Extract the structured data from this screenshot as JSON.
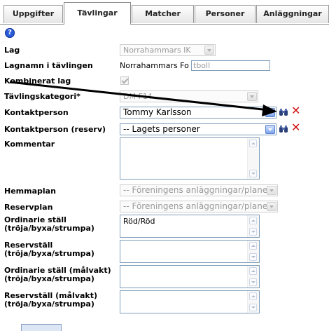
{
  "tabs": [
    "Uppgifter",
    "Tävlingar",
    "Matcher",
    "Personer",
    "Anläggningar"
  ],
  "active_tab": "Tävlingar",
  "help_icon": "?",
  "form": {
    "lag": {
      "label": "Lag",
      "value": "Norrahammars IK"
    },
    "lagnamn": {
      "label": "Lagnamn i tävlingen",
      "prefix": "Norrahammars Fo",
      "value": "tboll"
    },
    "kombinerat": {
      "label": "Kombinerat lag",
      "checked": true
    },
    "kategori": {
      "label": "Tävlingskategori*",
      "value": "DM F14"
    },
    "kontakt": {
      "label": "Kontaktperson",
      "value": "Tommy Karlsson"
    },
    "kontakt_reserv": {
      "label": "Kontaktperson (reserv)",
      "value": "-- Lagets personer"
    },
    "kommentar": {
      "label": "Kommentar",
      "value": ""
    },
    "hemmaplan": {
      "label": "Hemmaplan",
      "value": "-- Föreningens anläggningar/planer"
    },
    "reservplan": {
      "label": "Reservplan",
      "value": "-- Föreningens anläggningar/planer"
    },
    "ordinarie": {
      "label": "Ordinarie ställ (tröja/byxa/strumpa)",
      "value": "Röd/Röd"
    },
    "reservstall": {
      "label": "Reservställ (tröja/byxa/strumpa)",
      "value": ""
    },
    "ordinarie_malvakt": {
      "label": "Ordinarie ställ (målvakt) (tröja/byxa/strumpa)",
      "value": ""
    },
    "reserv_malvakt": {
      "label": "Reservställ (målvakt) (tröja/byxa/strumpa)",
      "value": ""
    }
  },
  "icons": {
    "search": "binoculars-icon",
    "remove": "close-icon",
    "remove_color": "#d01010"
  }
}
